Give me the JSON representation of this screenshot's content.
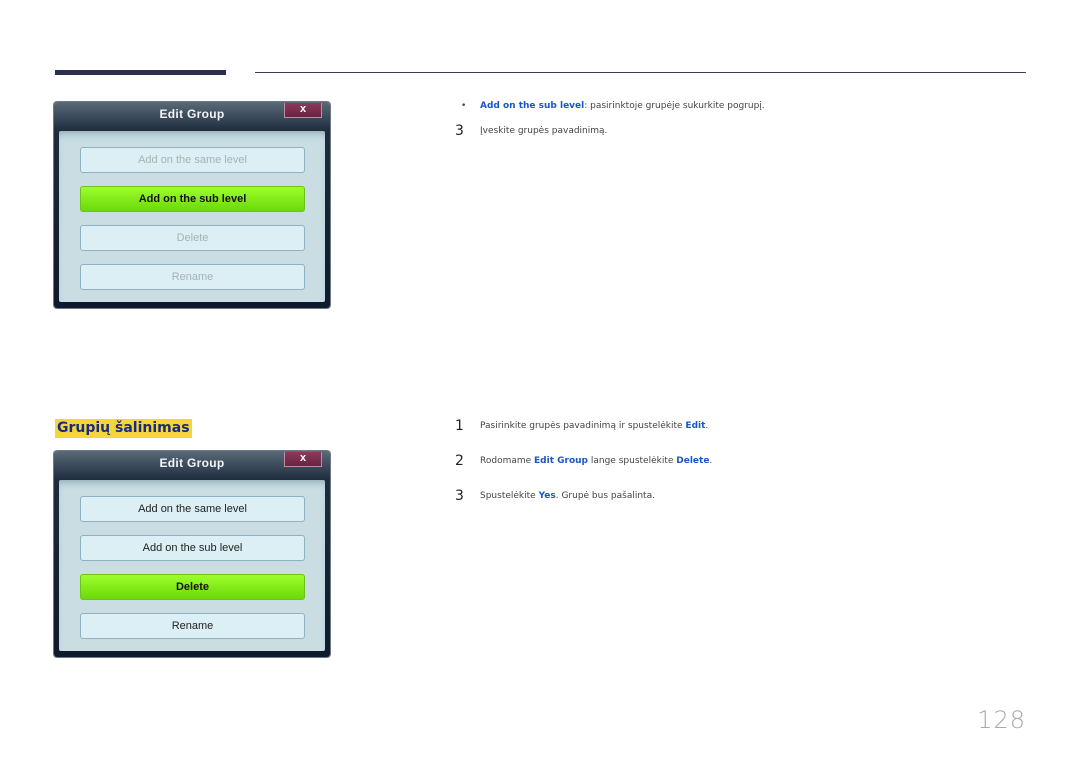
{
  "dialog1": {
    "title": "Edit Group",
    "close_label": "x",
    "buttons": [
      {
        "label": "Add on the same level",
        "state": "disabled"
      },
      {
        "label": "Add on the sub level",
        "state": "active"
      },
      {
        "label": "Delete",
        "state": "disabled"
      },
      {
        "label": "Rename",
        "state": "disabled"
      }
    ]
  },
  "section1": {
    "bullet": "•",
    "bullet_hl": "Add on the sub level",
    "bullet_text": ": pasirinktoje grupėje sukurkite pogrupį.",
    "step3_num": "3",
    "step3_text": "Įveskite grupės pavadinimą."
  },
  "heading": "Grupių šalinimas",
  "dialog2": {
    "title": "Edit Group",
    "close_label": "x",
    "buttons": [
      {
        "label": "Add on the same level",
        "state": "normal"
      },
      {
        "label": "Add on the sub level",
        "state": "normal"
      },
      {
        "label": "Delete",
        "state": "active"
      },
      {
        "label": "Rename",
        "state": "normal"
      }
    ]
  },
  "section2": {
    "steps": [
      {
        "num": "1",
        "t1": "Pasirinkite grupės pavadinimą ir spustelėkite ",
        "h1": "Edit",
        "t2": ".",
        "h2": "",
        "t3": ""
      },
      {
        "num": "2",
        "t1": "Rodomame ",
        "h1": "Edit Group",
        "t2": " lange spustelėkite ",
        "h2": "Delete",
        "t3": "."
      },
      {
        "num": "3",
        "t1": "Spustelėkite ",
        "h1": "Yes",
        "t2": ". Grupė bus pašalinta.",
        "h2": "",
        "t3": ""
      }
    ]
  },
  "page_number": "128",
  "colors": {
    "accent": "#1a56c8",
    "heading_bg": "#f5d63a",
    "active_button": "#7ee81a"
  }
}
